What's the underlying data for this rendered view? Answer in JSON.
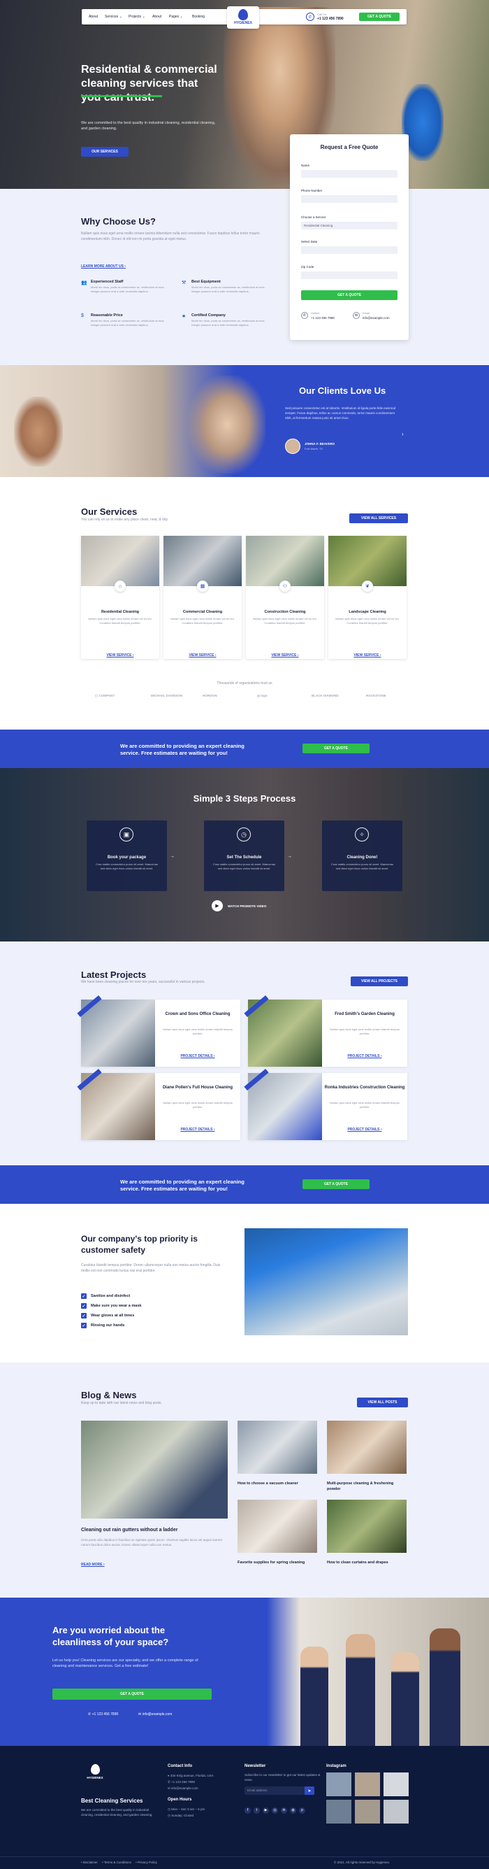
{
  "nav": {
    "items": [
      "About",
      "Services",
      "Projects",
      "About",
      "Pages",
      "Booking"
    ],
    "logo": "HYGIENEX",
    "call_label": "Call Us",
    "phone": "+1 123 456 7890",
    "quote_btn": "GET A QUOTE"
  },
  "hero": {
    "title_line1": "Residential & commercial",
    "title_line2": "cleaning services that",
    "title_line3": "you can trust.",
    "desc": "We are committed to the best quality in industrial cleaning, residential cleaning, and garden cleaning.",
    "btn": "OUR SERVICES"
  },
  "quote_form": {
    "title": "Request a Free Quote",
    "fields": [
      {
        "label": "Name",
        "value": ""
      },
      {
        "label": "Phone Number",
        "value": ""
      },
      {
        "label": "Choose a Service",
        "value": "Residential Cleaning"
      },
      {
        "label": "Select Date",
        "value": ""
      },
      {
        "label": "Zip Code",
        "value": ""
      }
    ],
    "submit": "GET A QUOTE",
    "hotline_label": "Hotline",
    "hotline": "+1 123 456 7890",
    "email_label": "Email",
    "email": "info@example.com"
  },
  "why": {
    "title": "Why Choose Us?",
    "desc": "Nullam quis risus eget urna mollis ornare lacinia bibendum nulla sed consectetur. Fusce dapibus tellus tortor mauris condimentum nibh. Donec id elit non mi porta gravida at eget metus.",
    "link": "LEARN MORE ABOUT US ›",
    "features": [
      {
        "title": "Experienced Staff",
        "desc": "Morbi leo risus, porta ac consectetur ac, vestibulum at eros. Integer posuere erat a ante venenatis dapibus."
      },
      {
        "title": "Best Equipment",
        "desc": "Morbi leo risus, porta ac consectetur ac, vestibulum at eros. Integer posuere erat a ante venenatis dapibus."
      },
      {
        "title": "Reasonable Price",
        "desc": "Morbi leo risus, porta ac consectetur ac, vestibulum at eros. Integer posuere erat a ante venenatis dapibus."
      },
      {
        "title": "Certified Company",
        "desc": "Morbi leo risus, porta ac consectetur ac, vestibulum at eros. Integer posuere erat a ante venenatis dapibus."
      }
    ]
  },
  "clients": {
    "title": "Our Clients Love Us",
    "quote": "Sed posuere consectetur est at lobortis. Vestibulum id ligula porta felis euismod semper. Fusce dapibus, tellus ac cursus commodo, tortor mauris condimentum nibh, ut fermentum massa justo sit amet risus.",
    "name": "JOHNA F. BEAVERS",
    "location": "Fort Worth, TX"
  },
  "services": {
    "title": "Our Services",
    "subtitle": "You can rely on us to make any place clean, neat, & tidy.",
    "btn": "VIEW ALL SERVICES",
    "items": [
      {
        "title": "Residential Cleaning",
        "desc": "Nullam quis risus eget urna mollis ornare vel eu leo. Curabitur blandit tempus porttitor.",
        "link": "VIEW SERVICE ›"
      },
      {
        "title": "Commercial Cleaning",
        "desc": "Nullam quis risus eget urna mollis ornare vel eu leo. Curabitur blandit tempus porttitor.",
        "link": "VIEW SERVICE ›"
      },
      {
        "title": "Construction Cleaning",
        "desc": "Nullam quis risus eget urna mollis ornare vel eu leo. Curabitur blandit tempus porttitor.",
        "link": "VIEW SERVICE ›"
      },
      {
        "title": "Landscape Cleaning",
        "desc": "Nullam quis risus eget urna mollis ornare vel eu leo. Curabitur blandit tempus porttitor.",
        "link": "VIEW SERVICE ›"
      }
    ],
    "trusted": "Thousands of organizations trust us",
    "logos": [
      "▢ COMPANY",
      "MICHAEL DAVIDSON",
      "HORIZON",
      "◎ logo",
      "BLACK DIAMOND",
      "ROCKSTONE"
    ]
  },
  "banner": {
    "text_line1": "We are committed to providing an expert cleaning",
    "text_line2": "service. Free estimates are waiting for you!",
    "btn": "GET A QUOTE"
  },
  "steps": {
    "title": "Simple 3 Steps Process",
    "items": [
      {
        "title": "Book your package",
        "desc": "Cras mattis consectetur purus sit amet. Maecenas sed diam eget risus varius blandit sit amet."
      },
      {
        "title": "Set The Schedule",
        "desc": "Cras mattis consectetur purus sit amet. Maecenas sed diam eget risus varius blandit sit amet."
      },
      {
        "title": "Cleaning Done!",
        "desc": "Cras mattis consectetur purus sit amet. Maecenas sed diam eget risus varius blandit sit amet."
      }
    ],
    "video": "WATCH PROMOTE VIDEO"
  },
  "projects": {
    "title": "Latest Projects",
    "subtitle": "We have been cleaning places for over ten years, successful in various projects.",
    "btn": "VIEW ALL PROJECTS",
    "items": [
      {
        "title": "Crown and Sons Office Cleaning",
        "desc": "Nullam quis risus eget urna mollis ornare blandit tempus porttitor.",
        "link": "PROJECT DETAILS ›"
      },
      {
        "title": "Fred Smith's Garden Cleaning",
        "desc": "Nullam quis risus eget urna mollis ornare blandit tempus porttitor.",
        "link": "PROJECT DETAILS ›"
      },
      {
        "title": "Diane Pollen's Full House Cleaning",
        "desc": "Nullam quis risus eget urna mollis ornare blandit tempus porttitor.",
        "link": "PROJECT DETAILS ›"
      },
      {
        "title": "Ronka Industries Construction Cleaning",
        "desc": "Nullam quis risus eget urna mollis ornare blandit tempus porttitor.",
        "link": "PROJECT DETAILS ›"
      }
    ]
  },
  "safety": {
    "title_line1": "Our company's top priority is",
    "title_line2": "customer safety",
    "desc": "Curabitur blandit tempus porttitor. Donec ullamcorper nulla non metus auctor fringilla. Duis mollis est non commodo luctus nisi erat porttitor.",
    "checks": [
      "Sanitize and disinfect",
      "Make sure you wear a mask",
      "Wear gloves at all times",
      "Rinsing our hands"
    ]
  },
  "blog": {
    "title": "Blog & News",
    "subtitle": "Keep up to date with our latest news and blog posts.",
    "btn": "VIEW ALL POSTS",
    "featured": {
      "title": "Cleaning out rain gutters without a ladder",
      "desc": "Urna porta odio dapibus in faucibus ac egestas quam ipsum. Vivamus sagittis lacus vel augue laoreet rutrum faucibus dolor auctor. Donec ullamcorper nulla non metus.",
      "link": "READ MORE ›"
    },
    "posts": [
      "How to choose a vacuum cleaner",
      "Multi-purpose cleaning & freshening powder",
      "Favorite supplies for spring cleaning",
      "How to clean curtains and drapes"
    ]
  },
  "cta": {
    "title_line1": "Are you worried about the",
    "title_line2": "cleanliness of your space?",
    "desc": "Let us help you! Cleaning services are our specialty, and we offer a complete range of cleaning and maintenance services. Get a free estimate!",
    "btn": "GET A QUOTE",
    "phone": "+1 123 456 7890",
    "email": "info@example.com"
  },
  "footer": {
    "logo": "HYGIENEX",
    "brand": "Best Cleaning Services",
    "brand_desc": "We are committed to the best quality in industrial cleaning, residential cleaning, and garden cleaning.",
    "contact_title": "Contact Info",
    "address": "334 Kirig avenue, Florida, USA",
    "phone": "+1 123 456 7890",
    "email": "info@example.com",
    "hours_title": "Open Hours",
    "hours1": "Mon – Sat: 8 am – 5 pm",
    "hours2": "Sunday: Closed",
    "newsletter_title": "Newsletter",
    "newsletter_desc": "Subscribe to our newsletter to get our latest updates & news.",
    "email_placeholder": "Email address",
    "instagram_title": "Instagram",
    "links": [
      "Disclaimer",
      "Terms & Conditions",
      "Privacy Policy"
    ],
    "copyright": "© 2021. All rights reserved by Hygienex."
  }
}
